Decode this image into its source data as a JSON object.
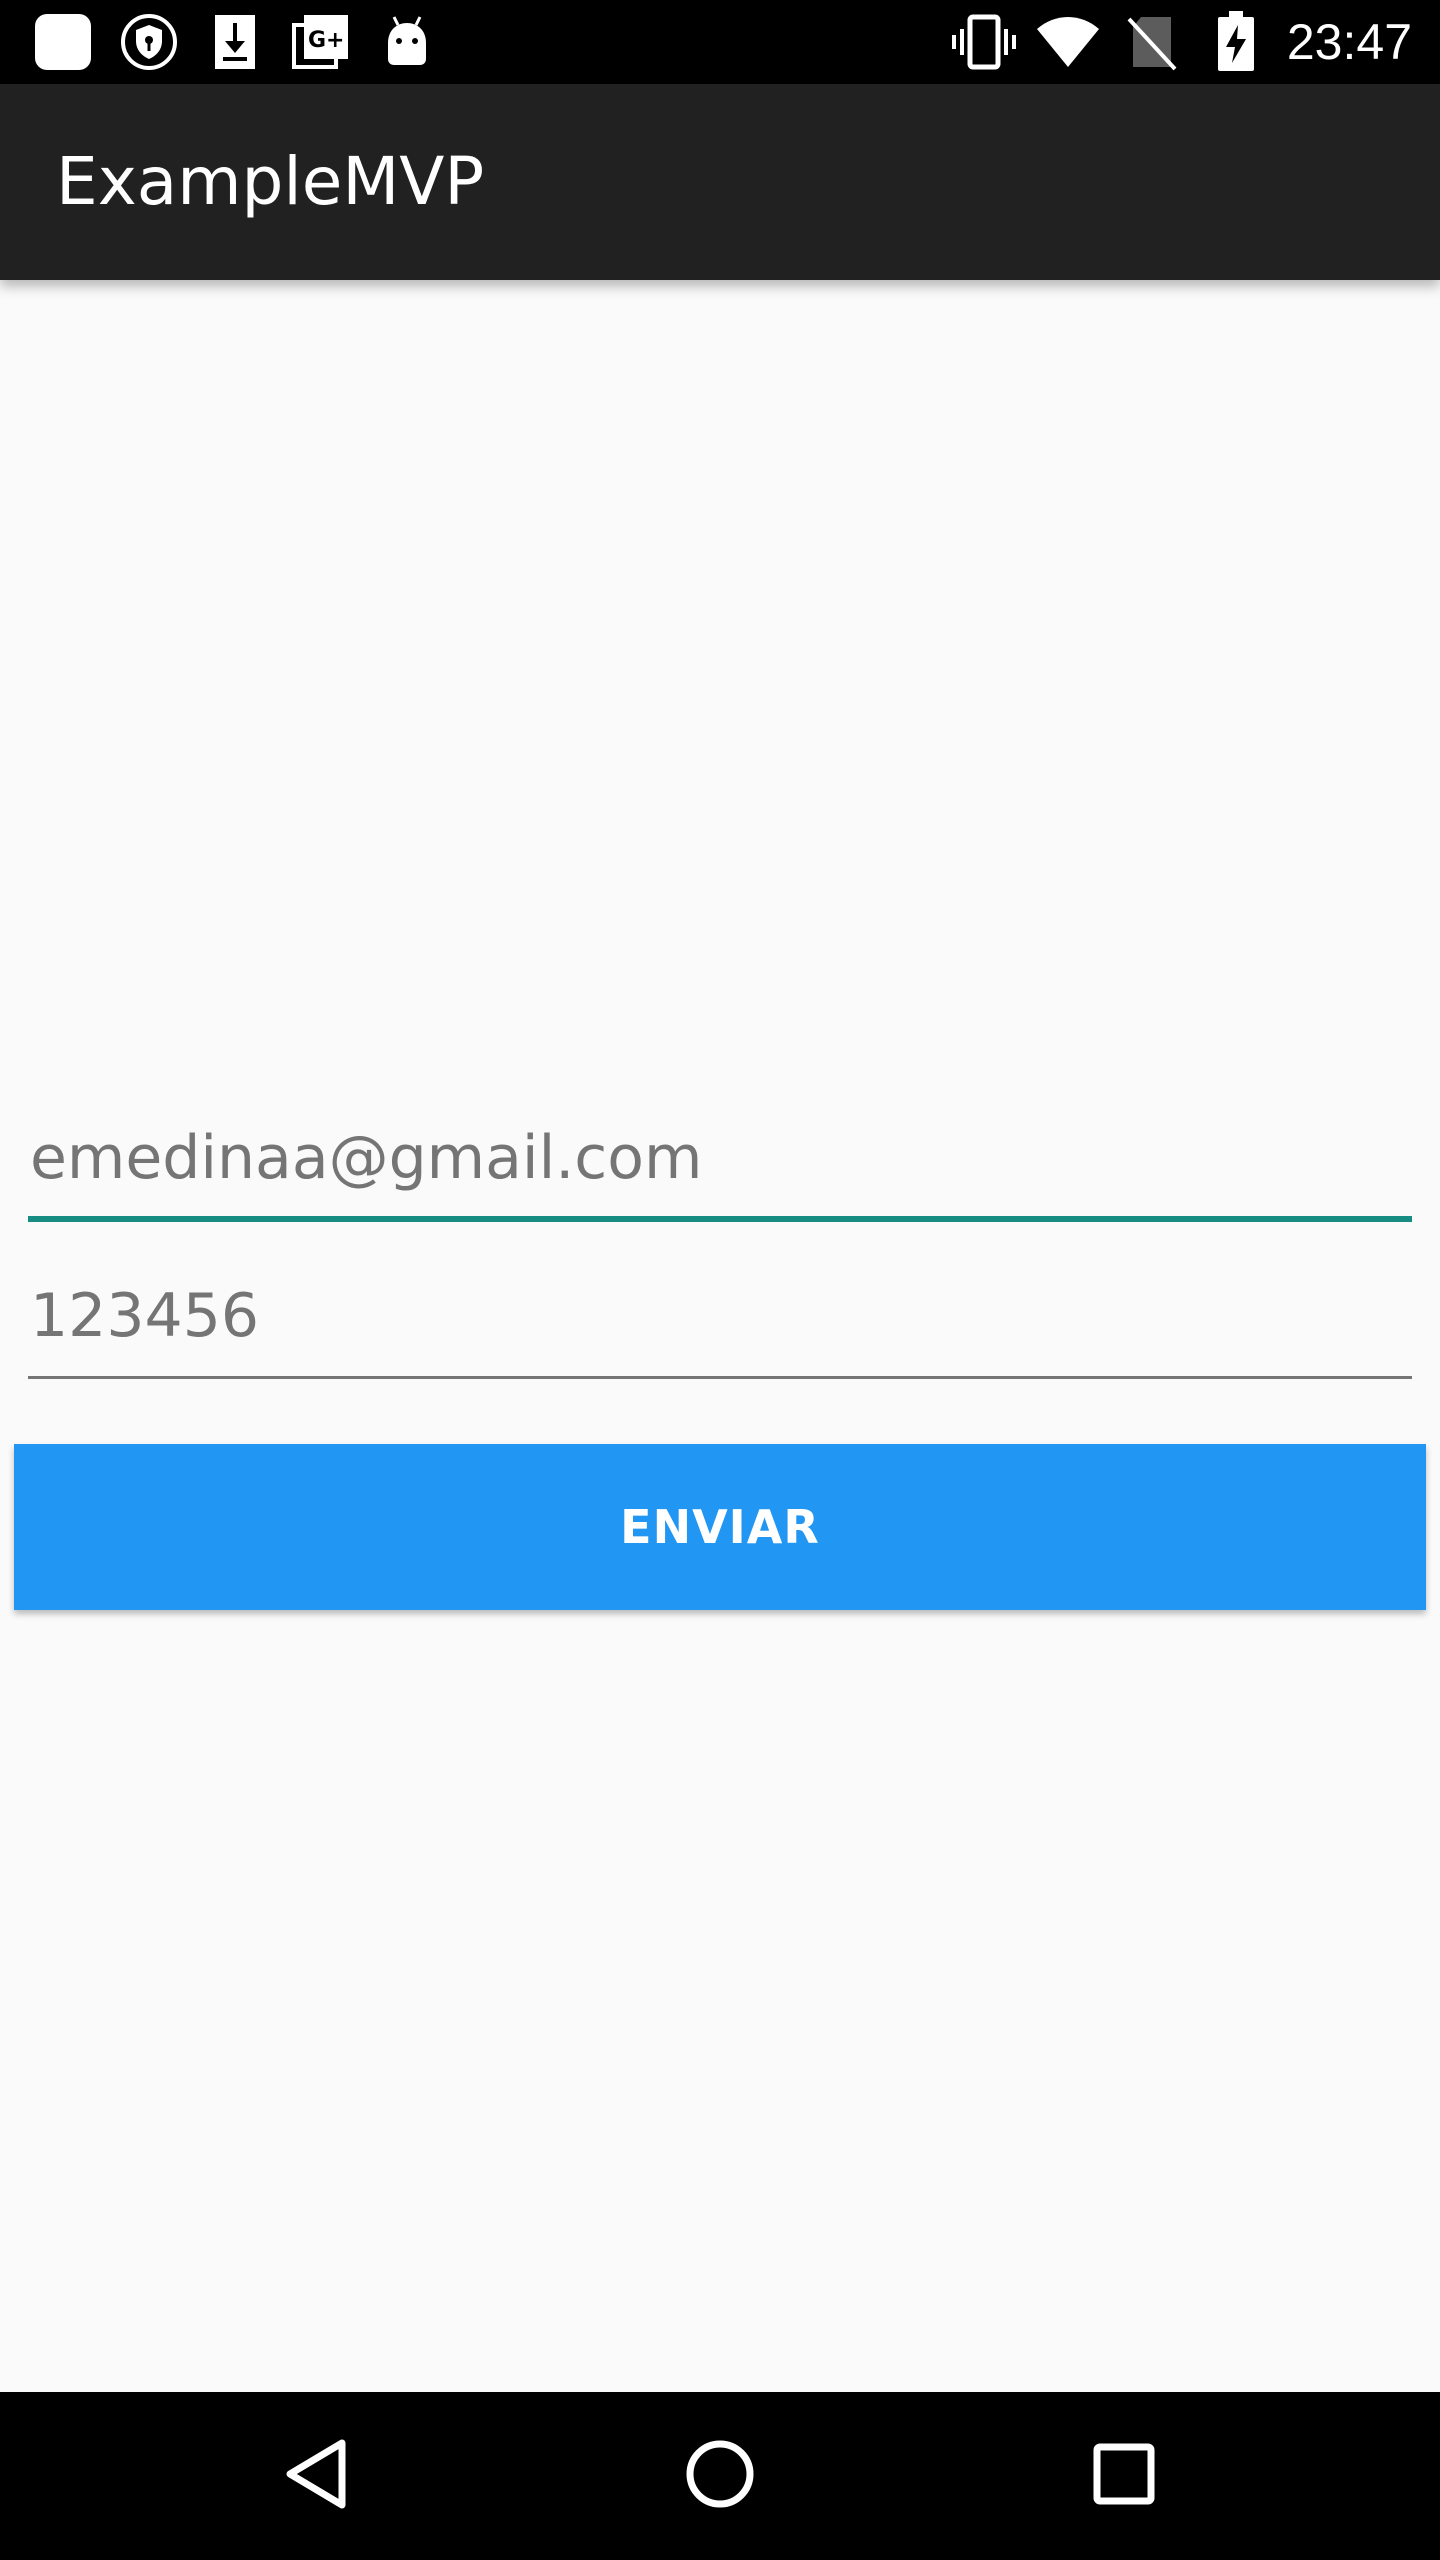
{
  "status_bar": {
    "time": "23:47",
    "left_icons": [
      "app-square-icon",
      "shield-key-icon",
      "download-icon",
      "google-plus-icon",
      "android-icon"
    ],
    "right_icons": [
      "vibrate-icon",
      "wifi-icon",
      "no-sim-icon",
      "battery-charging-icon"
    ]
  },
  "app_bar": {
    "title": "ExampleMVP"
  },
  "form": {
    "email_value": "emedinaa@gmail.com",
    "password_value": "123456",
    "submit_label": "ENVIAR"
  },
  "nav_bar": {
    "buttons": [
      "back-icon",
      "home-icon",
      "recents-icon"
    ]
  },
  "colors": {
    "status_bar": "#000000",
    "app_bar": "#212121",
    "accent": "#168c82",
    "button": "#2196f3",
    "background": "#fafafa"
  }
}
